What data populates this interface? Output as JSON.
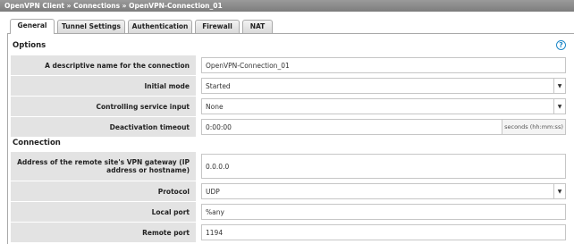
{
  "breadcrumb": "OpenVPN Client » Connections » OpenVPN-Connection_01",
  "tabs": [
    {
      "label": "General"
    },
    {
      "label": "Tunnel Settings"
    },
    {
      "label": "Authentication"
    },
    {
      "label": "Firewall"
    },
    {
      "label": "NAT"
    }
  ],
  "options": {
    "title": "Options",
    "name_label": "A descriptive name for the connection",
    "name_value": "OpenVPN-Connection_01",
    "initial_mode_label": "Initial mode",
    "initial_mode_value": "Started",
    "controlling_input_label": "Controlling service input",
    "controlling_input_value": "None",
    "deactivation_label": "Deactivation timeout",
    "deactivation_value": "0:00:00",
    "deactivation_unit": "seconds (hh:mm:ss)"
  },
  "connection": {
    "title": "Connection",
    "remote_address_label": "Address of the remote site's VPN gateway (IP address or hostname)",
    "remote_address_value": "0.0.0.0",
    "protocol_label": "Protocol",
    "protocol_value": "UDP",
    "local_port_label": "Local port",
    "local_port_value": "%any",
    "remote_port_label": "Remote port",
    "remote_port_value": "1194"
  },
  "icons": {
    "help": "help-icon",
    "dropdown": "chevron-down-icon"
  },
  "colors": {
    "help": "#1e88c8",
    "label_bg": "#e3e3e3",
    "titlebar": "#8a8a8a"
  }
}
